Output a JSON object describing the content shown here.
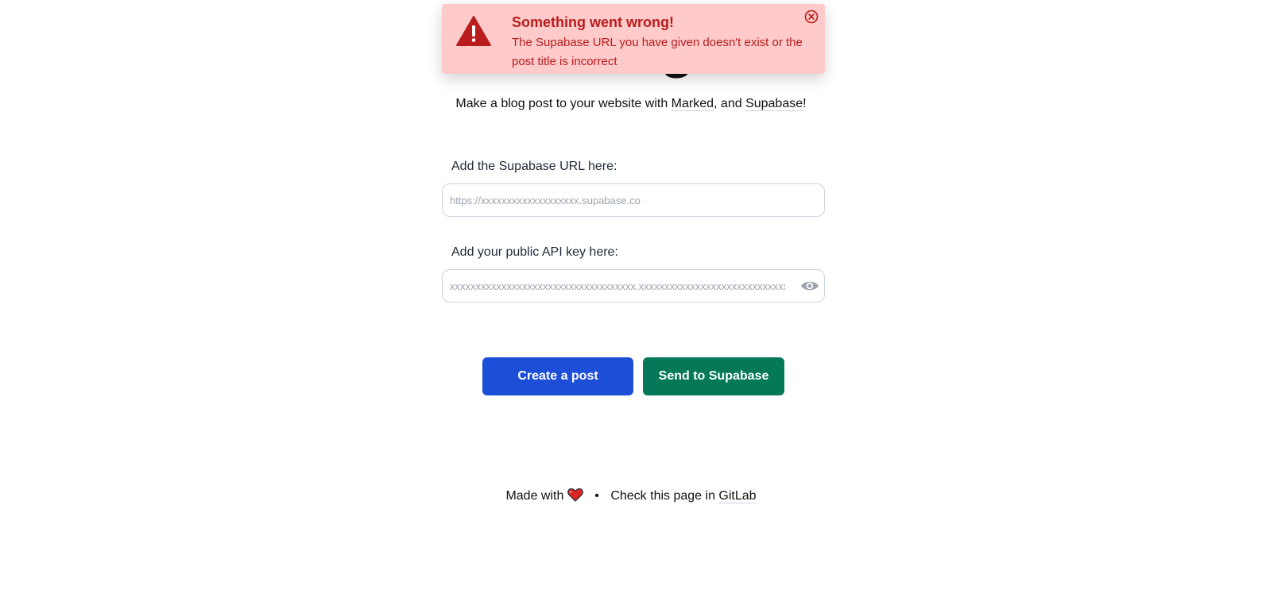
{
  "header": {
    "title": "Blog",
    "subtitle_prefix": "Make a blog post to your website with ",
    "subtitle_link1": "Marked",
    "subtitle_mid": ", and ",
    "subtitle_link2": "Supabase",
    "subtitle_suffix": "!"
  },
  "form": {
    "url_label": "Add the Supabase URL here:",
    "url_value": "",
    "url_placeholder": "https://xxxxxxxxxxxxxxxxxxx.supabase.co",
    "key_label": "Add your public API key here:",
    "key_value": "",
    "key_placeholder": "xxxxxxxxxxxxxxxxxxxxxxxxxxxxxxxxxxxx.xxxxxxxxxxxxxxxxxxxxxxxxxxxxxxxxxxxx"
  },
  "actions": {
    "create_label": "Create a post",
    "send_label": "Send to Supabase"
  },
  "footer": {
    "made_with": "Made with",
    "separator": "•",
    "check_text": "Check this page in",
    "link_label": "GitLab"
  },
  "toast": {
    "title": "Something went wrong!",
    "message": "The Supabase URL you have given doesn't exist or the post title is incorrect",
    "icon": "warning-triangle-icon",
    "close_icon": "close-circle-icon"
  },
  "colors": {
    "primary_button": "#1d4ed8",
    "secondary_button": "#047857",
    "toast_bg": "#fecaca",
    "toast_text": "#b91c1c"
  }
}
